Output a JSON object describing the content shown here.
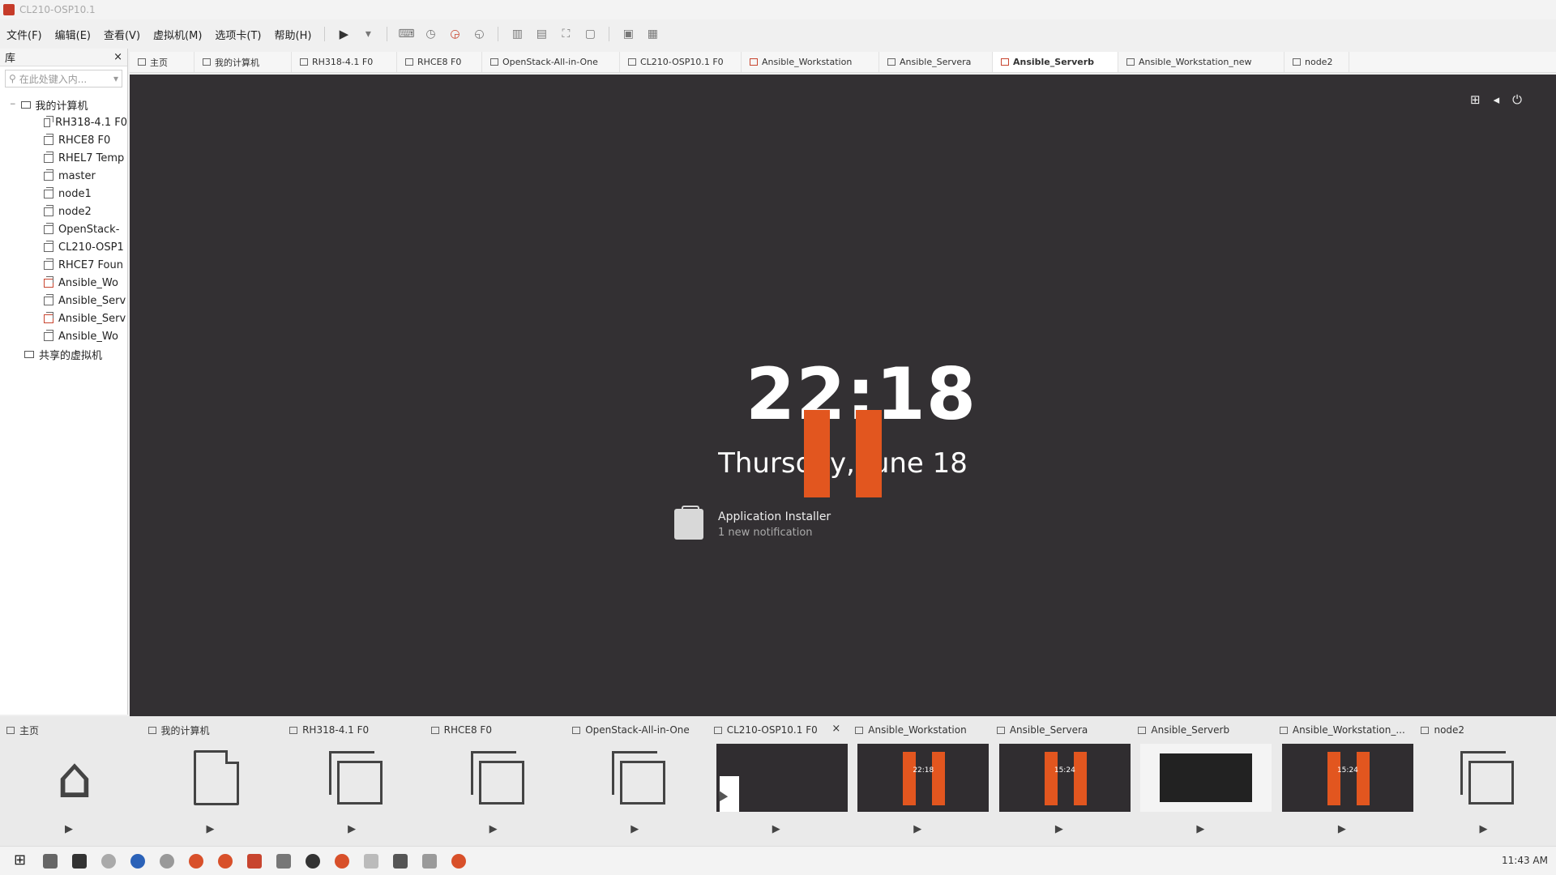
{
  "window": {
    "title": "CL210-OSP10.1"
  },
  "menu": [
    "文件(F)",
    "编辑(E)",
    "查看(V)",
    "虚拟机(M)",
    "选项卡(T)",
    "帮助(H)"
  ],
  "library": {
    "header": "库",
    "close": "×",
    "search_placeholder": "在此处键入内...",
    "root": "我的计算机",
    "items": [
      {
        "label": "RH318-4.1 F0",
        "red": false
      },
      {
        "label": "RHCE8 F0",
        "red": false
      },
      {
        "label": "RHEL7 Temp",
        "red": false
      },
      {
        "label": "master",
        "red": false
      },
      {
        "label": "node1",
        "red": false
      },
      {
        "label": "node2",
        "red": false
      },
      {
        "label": "OpenStack-",
        "red": false
      },
      {
        "label": "CL210-OSP1",
        "red": false
      },
      {
        "label": "RHCE7 Foun",
        "red": false
      },
      {
        "label": "Ansible_Wo",
        "red": true
      },
      {
        "label": "Ansible_Serv",
        "red": false
      },
      {
        "label": "Ansible_Serv",
        "red": true
      },
      {
        "label": "Ansible_Wo",
        "red": false
      }
    ],
    "shared": "共享的虚拟机"
  },
  "tabs": [
    {
      "label": "主页",
      "active": false
    },
    {
      "label": "我的计算机",
      "active": false
    },
    {
      "label": "RH318-4.1 F0",
      "active": false
    },
    {
      "label": "RHCE8 F0",
      "active": false
    },
    {
      "label": "OpenStack-All-in-One",
      "active": false
    },
    {
      "label": "CL210-OSP10.1 F0",
      "active": false
    },
    {
      "label": "Ansible_Workstation",
      "active": false
    },
    {
      "label": "Ansible_Servera",
      "active": false
    },
    {
      "label": "Ansible_Serverb",
      "active": true
    },
    {
      "label": "Ansible_Workstation_new",
      "active": false
    },
    {
      "label": "node2",
      "active": false
    }
  ],
  "console": {
    "time": "22:18",
    "date": "Thursday, June 18",
    "notification_title": "Application Installer",
    "notification_sub": "1 new notification"
  },
  "thumbnails": [
    {
      "label": "主页",
      "kind": "home"
    },
    {
      "label": "我的计算机",
      "kind": "doc"
    },
    {
      "label": "RH318-4.1 F0",
      "kind": "vm"
    },
    {
      "label": "RHCE8 F0",
      "kind": "vm"
    },
    {
      "label": "OpenStack-All-in-One",
      "kind": "vm"
    },
    {
      "label": "CL210-OSP10.1 F0",
      "kind": "dark",
      "close": "×"
    },
    {
      "label": "Ansible_Workstation",
      "kind": "paused",
      "mini": "22:18"
    },
    {
      "label": "Ansible_Servera",
      "kind": "paused",
      "mini": "15:24"
    },
    {
      "label": "Ansible_Serverb",
      "kind": "white"
    },
    {
      "label": "Ansible_Workstation_...",
      "kind": "paused",
      "mini": "15:24"
    },
    {
      "label": "node2",
      "kind": "vm"
    }
  ],
  "taskbar": {
    "time": "11:43 AM"
  },
  "colors": {
    "accent": "#e2561f",
    "console_bg": "#333033"
  }
}
